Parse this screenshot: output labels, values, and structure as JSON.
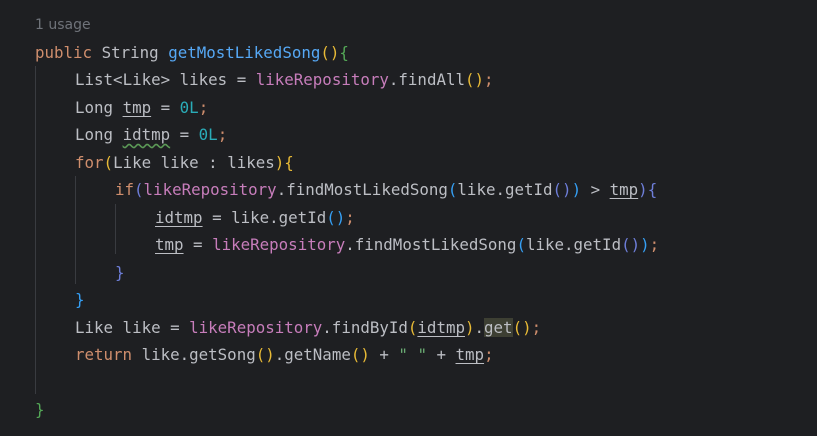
{
  "editor": {
    "usage_hint": "1 usage"
  },
  "code": {
    "l1": {
      "public": "public",
      "type": "String",
      "name": "getMostLikedSong",
      "lp": "(",
      "rp": ")",
      "lb": "{"
    },
    "l2": {
      "type": "List",
      "lt": "<",
      "generic": "Like",
      "gt": ">",
      "rest": " likes = ",
      "repo": "likeRepository",
      "dot": ".",
      "method": "findAll",
      "lp": "(",
      "rp": ")",
      "semi": ";"
    },
    "l3": {
      "type": "Long",
      "var": "tmp",
      "eq": " = ",
      "val": "0L",
      "semi": ";"
    },
    "l4": {
      "type": "Long",
      "var": "idtmp",
      "eq": " = ",
      "val": "0L",
      "semi": ";"
    },
    "l5": {
      "kw": "for",
      "lp": "(",
      "body": "Like like : likes",
      "rp": ")",
      "lb": "{"
    },
    "l6": {
      "kw": "if",
      "lp": "(",
      "repo": "likeRepository",
      "method": ".findMostLikedSong",
      "lp2": "(",
      "arg": "like.getId",
      "lp3": "(",
      "rp3": ")",
      "rp2": ")",
      "cmp": " > ",
      "var": "tmp",
      "rp": ")",
      "lb": "{"
    },
    "l7": {
      "var": "idtmp",
      "eq": " = ",
      "call": "like.getId",
      "lp": "(",
      "rp": ")",
      "semi": ";"
    },
    "l8": {
      "var": "tmp",
      "eq": " = ",
      "repo": "likeRepository",
      "method": ".findMostLikedSong",
      "lp": "(",
      "arg": "like.getId",
      "lp2": "(",
      "rp2": ")",
      "rp": ")",
      "semi": ";"
    },
    "l9": {
      "rb": "}"
    },
    "l10": {
      "rb": "}"
    },
    "l11": {
      "decl": "Like like = ",
      "repo": "likeRepository",
      "method": ".findById",
      "lp": "(",
      "var": "idtmp",
      "rp": ")",
      "dot": ".",
      "get": "get",
      "lp2": "(",
      "rp2": ")",
      "semi": ";"
    },
    "l12": {
      "kw": "return",
      "call1": " like.getSong",
      "lp": "(",
      "rp": ")",
      "call2": ".getName",
      "lp2": "(",
      "rp2": ")",
      "plus": " + ",
      "str": "\" \"",
      "plus2": " + ",
      "var": "tmp",
      "semi": ";"
    },
    "l14": {
      "rb": "}"
    }
  }
}
